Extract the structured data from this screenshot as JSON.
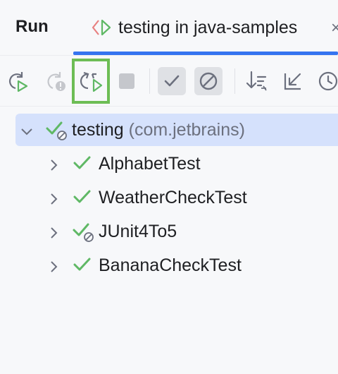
{
  "header": {
    "title": "Run",
    "tab_label": "testing in java-samples",
    "tab_close": "×"
  },
  "toolbar": {
    "buttons": [
      {
        "name": "rerun-icon"
      },
      {
        "name": "rerun-failed-icon"
      },
      {
        "name": "toggle-auto-test-icon"
      },
      {
        "name": "stop-icon"
      },
      {
        "name": "show-passed-icon"
      },
      {
        "name": "show-ignored-icon"
      },
      {
        "name": "sort-icon"
      },
      {
        "name": "import-tests-icon"
      },
      {
        "name": "history-icon"
      }
    ]
  },
  "tree": {
    "root": {
      "label": "testing",
      "sub": "(com.jetbrains)",
      "status": "passed-with-ignored"
    },
    "children": [
      {
        "label": "AlphabetTest",
        "status": "passed"
      },
      {
        "label": "WeatherCheckTest",
        "status": "passed"
      },
      {
        "label": "JUnit4To5",
        "status": "passed-with-ignored"
      },
      {
        "label": "BananaCheckTest",
        "status": "passed"
      }
    ]
  },
  "colors": {
    "accent": "#3574f0",
    "pass": "#5fb865",
    "highlight": "#6dbd55",
    "selection": "#d5e1fc"
  }
}
